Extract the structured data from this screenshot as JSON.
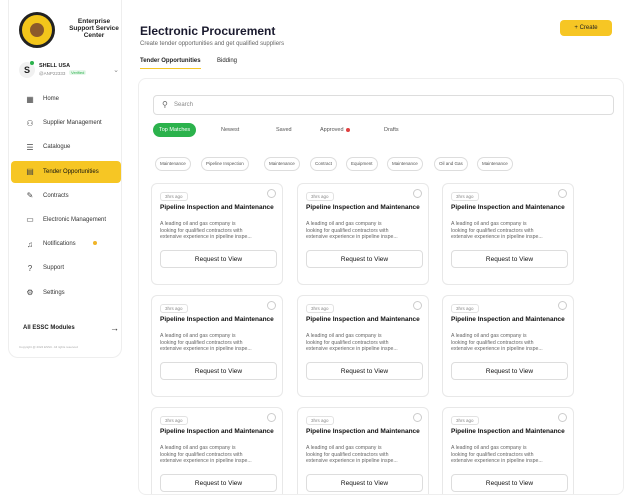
{
  "brand": {
    "line1": "Enterprise",
    "line2": "Support Service",
    "line3": "Center"
  },
  "account": {
    "initial": "S",
    "name": "SHELL USA",
    "id": "@ANP22333",
    "verified": "Verified"
  },
  "nav": [
    {
      "label": "Home",
      "icon": "grid-icon",
      "glyph": "▦"
    },
    {
      "label": "Supplier Management",
      "icon": "users-icon",
      "glyph": "⚇"
    },
    {
      "label": "Catalogue",
      "icon": "list-icon",
      "glyph": "☰"
    },
    {
      "label": "Tender Opportunities",
      "icon": "tender-icon",
      "glyph": "▤"
    },
    {
      "label": "Contracts",
      "icon": "edit-icon",
      "glyph": "✎"
    },
    {
      "label": "Electronic Management",
      "icon": "folder-icon",
      "glyph": "▭"
    },
    {
      "label": "Notifications",
      "icon": "bell-icon",
      "glyph": "♫"
    },
    {
      "label": "Support",
      "icon": "support-icon",
      "glyph": "?"
    },
    {
      "label": "Settings",
      "icon": "gear-icon",
      "glyph": "⚙"
    }
  ],
  "all_modules": "All ESSC Modules",
  "copyright": "Copyright @ 2024 ESSC. All rights reserved",
  "header": {
    "title": "Electronic Procurement",
    "subtitle": "Create tender opportunities and get qualified suppliers",
    "create_label": "+ Create"
  },
  "tabs": [
    "Tender Opportunities",
    "Bidding"
  ],
  "search": {
    "placeholder": "Search"
  },
  "filters": [
    "Top Matches",
    "Newest",
    "Saved",
    "Approved",
    "Drafts"
  ],
  "chips": [
    "Maintenance",
    "Pipeline Inspection",
    "Maintenance",
    "Contract",
    "Equipment",
    "Maintenance",
    "Oil and Gas",
    "Maintenance"
  ],
  "card": {
    "time": "3hrs ago",
    "title": "Pipeline Inspection and Maintenance",
    "desc_line1": "A leading oil and gas company is",
    "desc_line2": "looking for qualified contractors with",
    "desc_line3": "extensive experience in pipeline inspe...",
    "button": "Request to View"
  },
  "colors": {
    "accent": "#f6c624",
    "green": "#2bb24c",
    "red": "#e04040"
  }
}
